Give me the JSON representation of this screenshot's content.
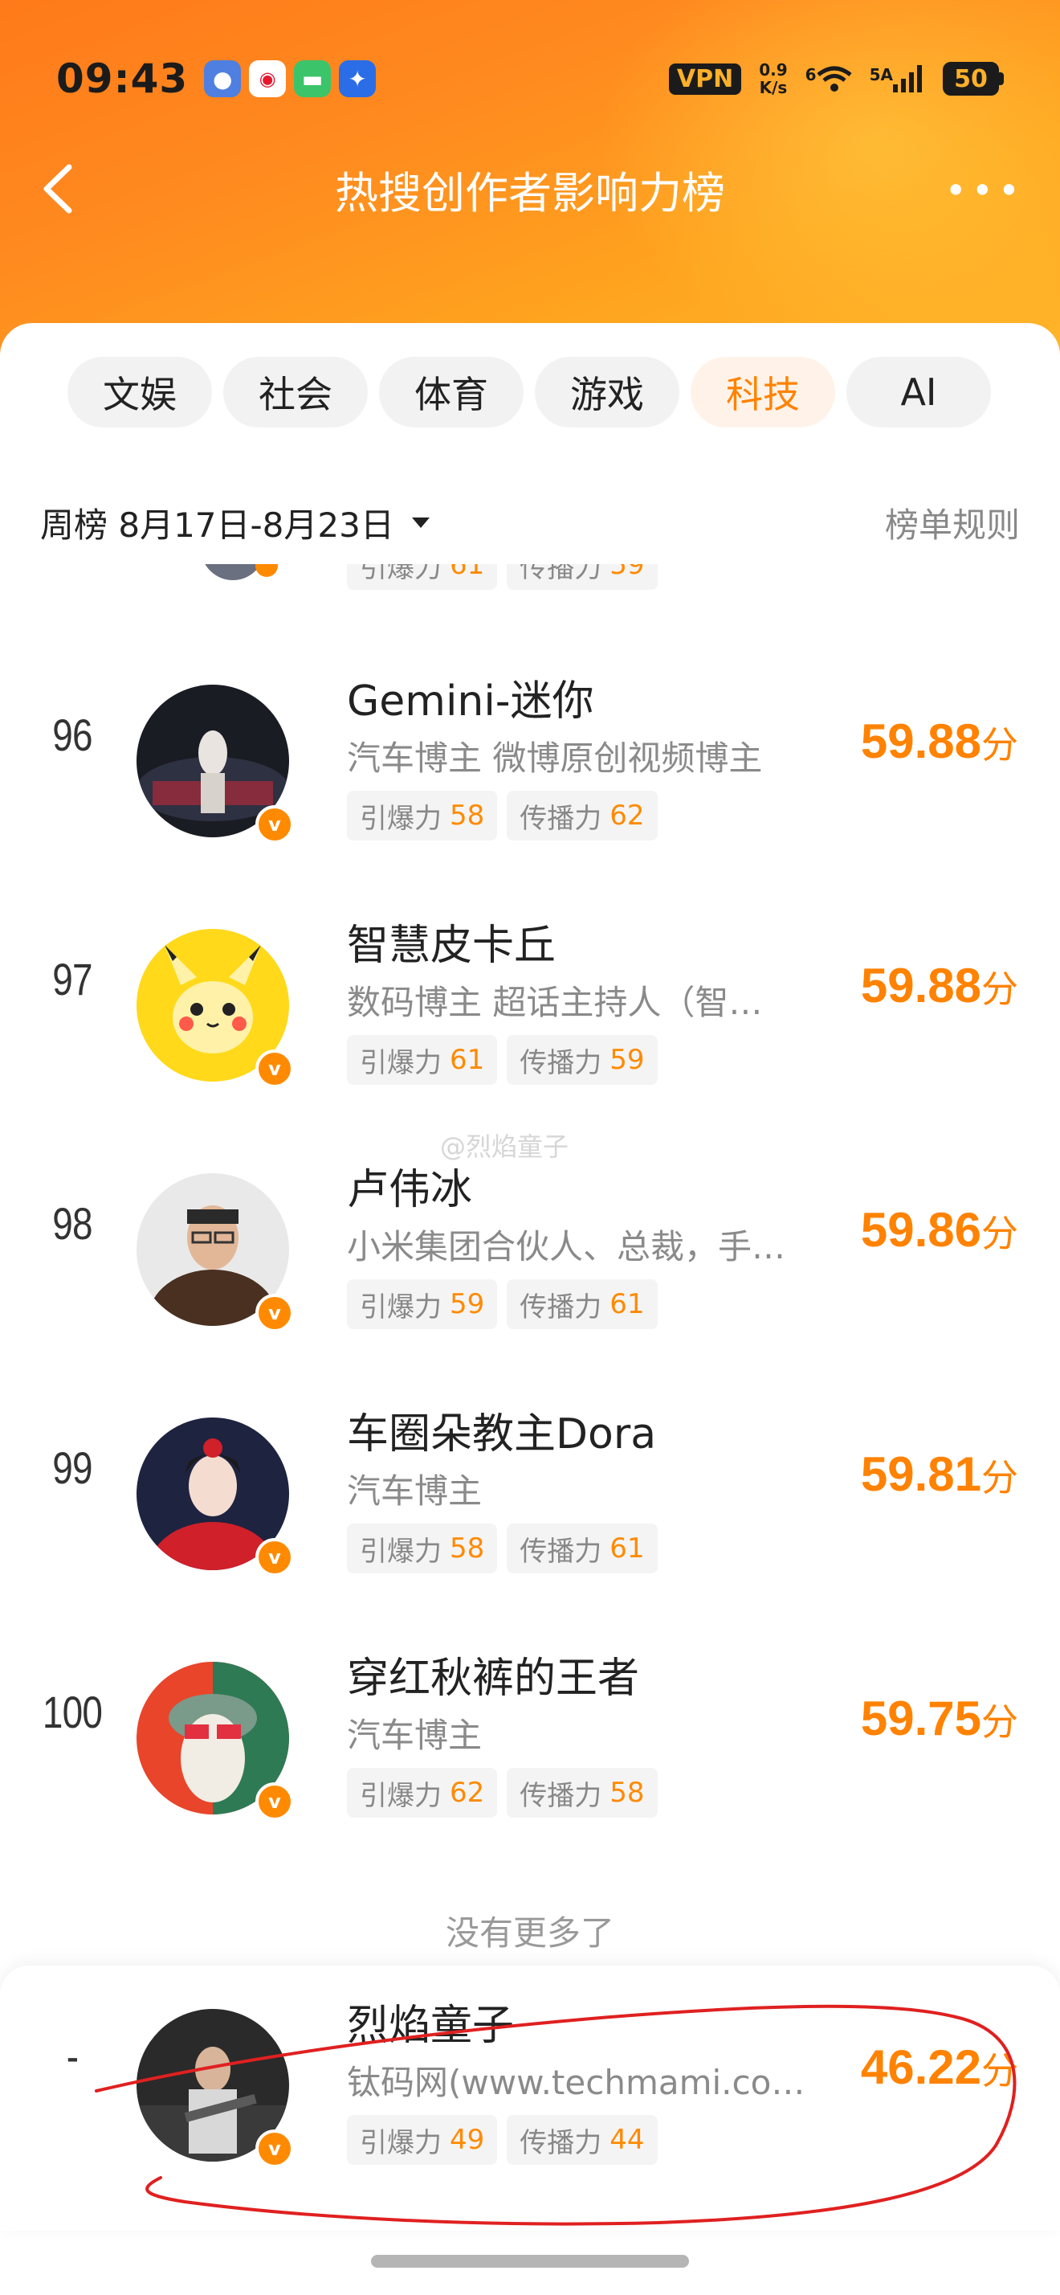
{
  "status_bar": {
    "time": "09:43",
    "vpn": "VPN",
    "speed_value": "0.9",
    "speed_unit": "K/s",
    "wifi_label": "6",
    "signal_label": "5A",
    "battery": "50"
  },
  "header": {
    "title": "热搜创作者影响力榜"
  },
  "tabs": [
    {
      "label": "文娱",
      "active": false
    },
    {
      "label": "社会",
      "active": false
    },
    {
      "label": "体育",
      "active": false
    },
    {
      "label": "游戏",
      "active": false
    },
    {
      "label": "科技",
      "active": true
    },
    {
      "label": "AI",
      "active": false
    }
  ],
  "period": {
    "label": "周榜 8月17日-8月23日"
  },
  "rules_label": "榜单规则",
  "metric_labels": {
    "ignite": "引爆力",
    "spread": "传播力"
  },
  "score_unit": "分",
  "partial_row": {
    "ignite": "61",
    "spread": "59"
  },
  "rows": [
    {
      "rank": "96",
      "name": "Gemini-迷你",
      "desc": "汽车博主 微博原创视频博主",
      "ignite": "58",
      "spread": "62",
      "score": "59.88"
    },
    {
      "rank": "97",
      "name": "智慧皮卡丘",
      "desc": "数码博主 超话主持人（智…",
      "ignite": "61",
      "spread": "59",
      "score": "59.88"
    },
    {
      "rank": "98",
      "name": "卢伟冰",
      "desc": "小米集团合伙人、总裁，手…",
      "ignite": "59",
      "spread": "61",
      "score": "59.86"
    },
    {
      "rank": "99",
      "name": "车圈朵教主Dora",
      "desc": "汽车博主",
      "ignite": "58",
      "spread": "61",
      "score": "59.81"
    },
    {
      "rank": "100",
      "name": "穿红秋裤的王者",
      "desc": "汽车博主",
      "ignite": "62",
      "spread": "58",
      "score": "59.75"
    }
  ],
  "watermark": "@烈焰童子",
  "no_more": "没有更多了",
  "me": {
    "rank": "-",
    "name": "烈焰童子",
    "desc": "钛码网(www.techmami.co…",
    "ignite": "49",
    "spread": "44",
    "score": "46.22"
  },
  "verified_badge": "v"
}
